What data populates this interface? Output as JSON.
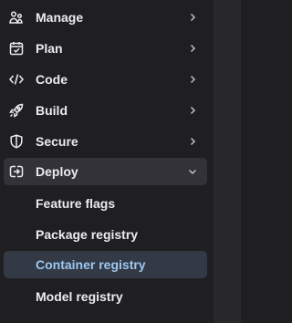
{
  "sidebar": {
    "items": [
      {
        "label": "Manage",
        "icon": "users-icon",
        "chevron": "right"
      },
      {
        "label": "Plan",
        "icon": "calendar-icon",
        "chevron": "right"
      },
      {
        "label": "Code",
        "icon": "code-icon",
        "chevron": "right"
      },
      {
        "label": "Build",
        "icon": "rocket-icon",
        "chevron": "right"
      },
      {
        "label": "Secure",
        "icon": "shield-icon",
        "chevron": "right"
      },
      {
        "label": "Deploy",
        "icon": "deploy-icon",
        "chevron": "down",
        "expanded": true
      }
    ],
    "deploy_subitems": [
      {
        "label": "Feature flags"
      },
      {
        "label": "Package registry"
      },
      {
        "label": "Container registry",
        "active": true
      },
      {
        "label": "Model registry"
      }
    ]
  },
  "colors": {
    "background": "#1f1f22",
    "text": "#ececef",
    "active_text": "#9dc7f1",
    "expanded_bg": "#333238",
    "active_bg": "#333a45"
  }
}
